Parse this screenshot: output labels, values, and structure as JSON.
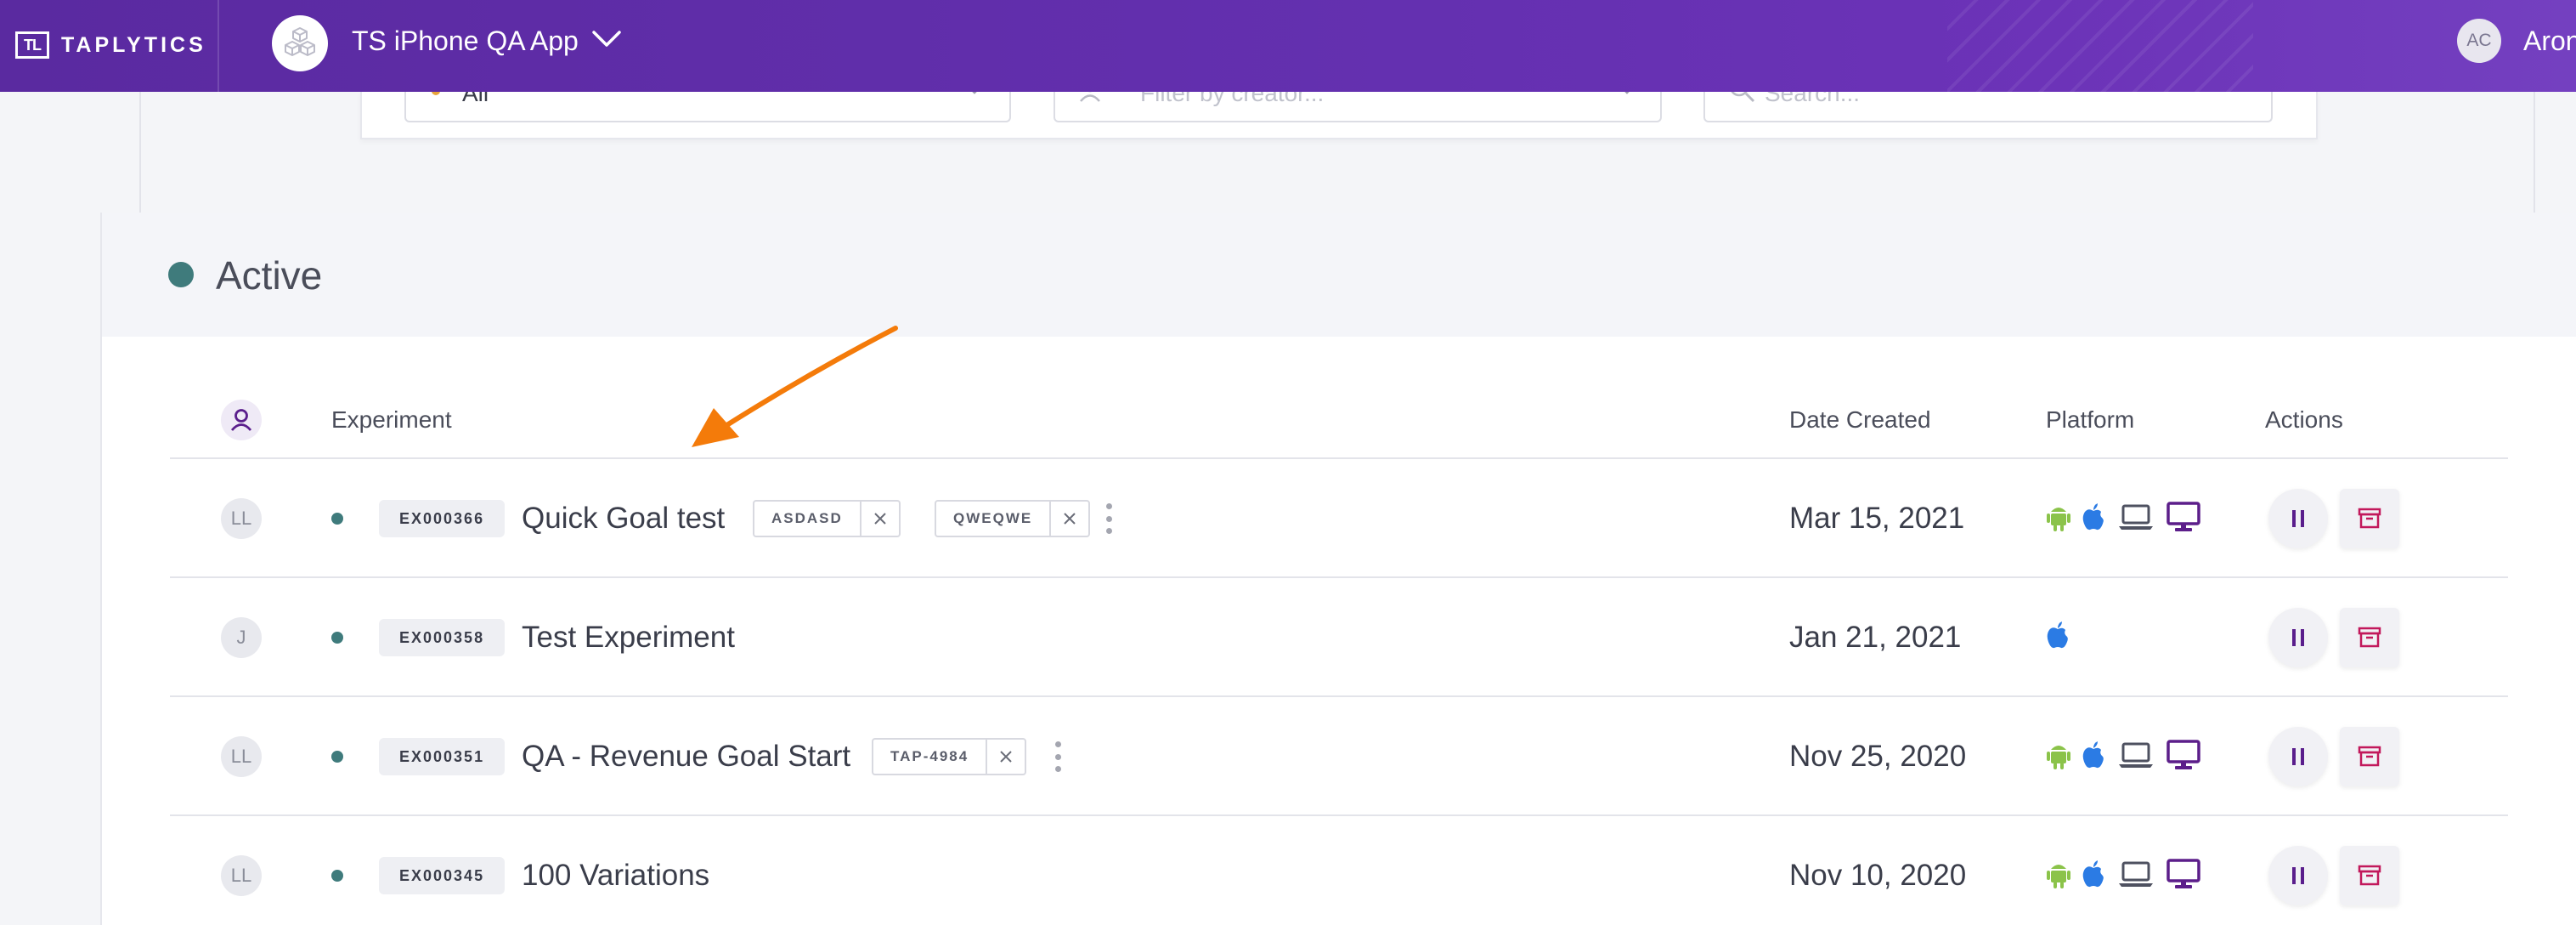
{
  "header": {
    "logo_mark": "TL",
    "logo_text": "TAPLYTICS",
    "app_name": "TS iPhone QA App",
    "user_initials": "AC",
    "user_name": "Aron"
  },
  "filters": {
    "platform_value": "All",
    "creator_placeholder": "Filter by creator...",
    "search_placeholder": "Search..."
  },
  "section": {
    "title": "Active",
    "status_color": "#3f7b7c"
  },
  "table": {
    "columns": {
      "experiment": "Experiment",
      "date_created": "Date Created",
      "platform": "Platform",
      "actions": "Actions"
    },
    "rows": [
      {
        "creator": "LL",
        "id": "EX000366",
        "name": "Quick Goal test",
        "tags": [
          "ASDASD",
          "QWEQWE"
        ],
        "date": "Mar 15, 2021",
        "platforms": [
          "android",
          "ios",
          "web",
          "desktop"
        ]
      },
      {
        "creator": "J",
        "id": "EX000358",
        "name": "Test Experiment",
        "tags": [],
        "date": "Jan 21, 2021",
        "platforms": [
          "ios"
        ]
      },
      {
        "creator": "LL",
        "id": "EX000351",
        "name": "QA - Revenue Goal Start",
        "tags": [
          "TAP-4984"
        ],
        "date": "Nov 25, 2020",
        "platforms": [
          "android",
          "ios",
          "web",
          "desktop"
        ]
      },
      {
        "creator": "LL",
        "id": "EX000345",
        "name": "100 Variations",
        "tags": [],
        "date": "Nov 10, 2020",
        "platforms": [
          "android",
          "ios",
          "web",
          "desktop"
        ]
      }
    ]
  },
  "colors": {
    "brand_purple": "#5a2aa0",
    "android_green": "#8bc34a",
    "ios_blue": "#2b7be4",
    "desktop_purple": "#5c1e8a",
    "archive_red": "#c2185b",
    "annotation_orange": "#f47b0a"
  }
}
